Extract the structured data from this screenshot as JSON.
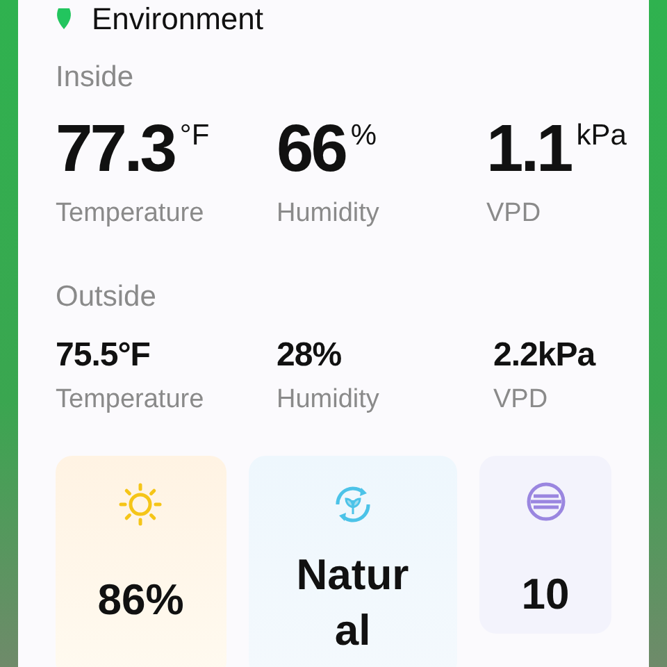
{
  "header": {
    "title": "Environment"
  },
  "inside": {
    "label": "Inside",
    "metrics": [
      {
        "value": "77.3",
        "unit": "°F",
        "label": "Temperature"
      },
      {
        "value": "66",
        "unit": "%",
        "label": "Humidity"
      },
      {
        "value": "1.1",
        "unit": "kPa",
        "label": "VPD"
      }
    ]
  },
  "outside": {
    "label": "Outside",
    "metrics": [
      {
        "value": "75.5°F",
        "label": "Temperature"
      },
      {
        "value": "28%",
        "label": "Humidity"
      },
      {
        "value": "2.2kPa",
        "label": "VPD"
      }
    ]
  },
  "tiles": [
    {
      "kind": "light",
      "value": "86%"
    },
    {
      "kind": "mode",
      "value": "Natural"
    },
    {
      "kind": "fan",
      "value": "10"
    }
  ]
}
